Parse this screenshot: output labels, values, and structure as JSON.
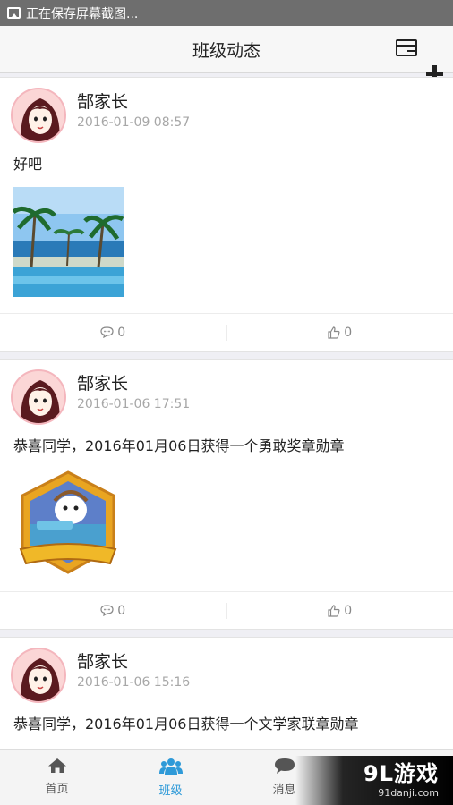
{
  "status_bar": {
    "text": "正在保存屏幕截图..."
  },
  "header": {
    "title": "班级动态"
  },
  "posts": [
    {
      "author": "郜家长",
      "time": "2016-01-09 08:57",
      "text": "好吧",
      "comment_count": "0",
      "like_count": "0"
    },
    {
      "author": "郜家长",
      "time": "2016-01-06 17:51",
      "text": "恭喜同学，2016年01月06日获得一个勇敢奖章勋章",
      "badge_text": "勇敢奖章",
      "comment_count": "0",
      "like_count": "0"
    },
    {
      "author": "郜家长",
      "time": "2016-01-06 15:16",
      "text": "恭喜同学，2016年01月06日获得一个文学家联章勋章"
    }
  ],
  "tabs": [
    {
      "label": "首页",
      "icon": "home-icon"
    },
    {
      "label": "班级",
      "icon": "class-group-icon",
      "active": true
    },
    {
      "label": "消息",
      "icon": "message-icon"
    }
  ],
  "watermark": {
    "logo": "9L游戏",
    "url": "91danji.com"
  },
  "colors": {
    "accent": "#2f9ad8",
    "header_bg": "#f7f7f7",
    "page_bg": "#efeff4"
  }
}
